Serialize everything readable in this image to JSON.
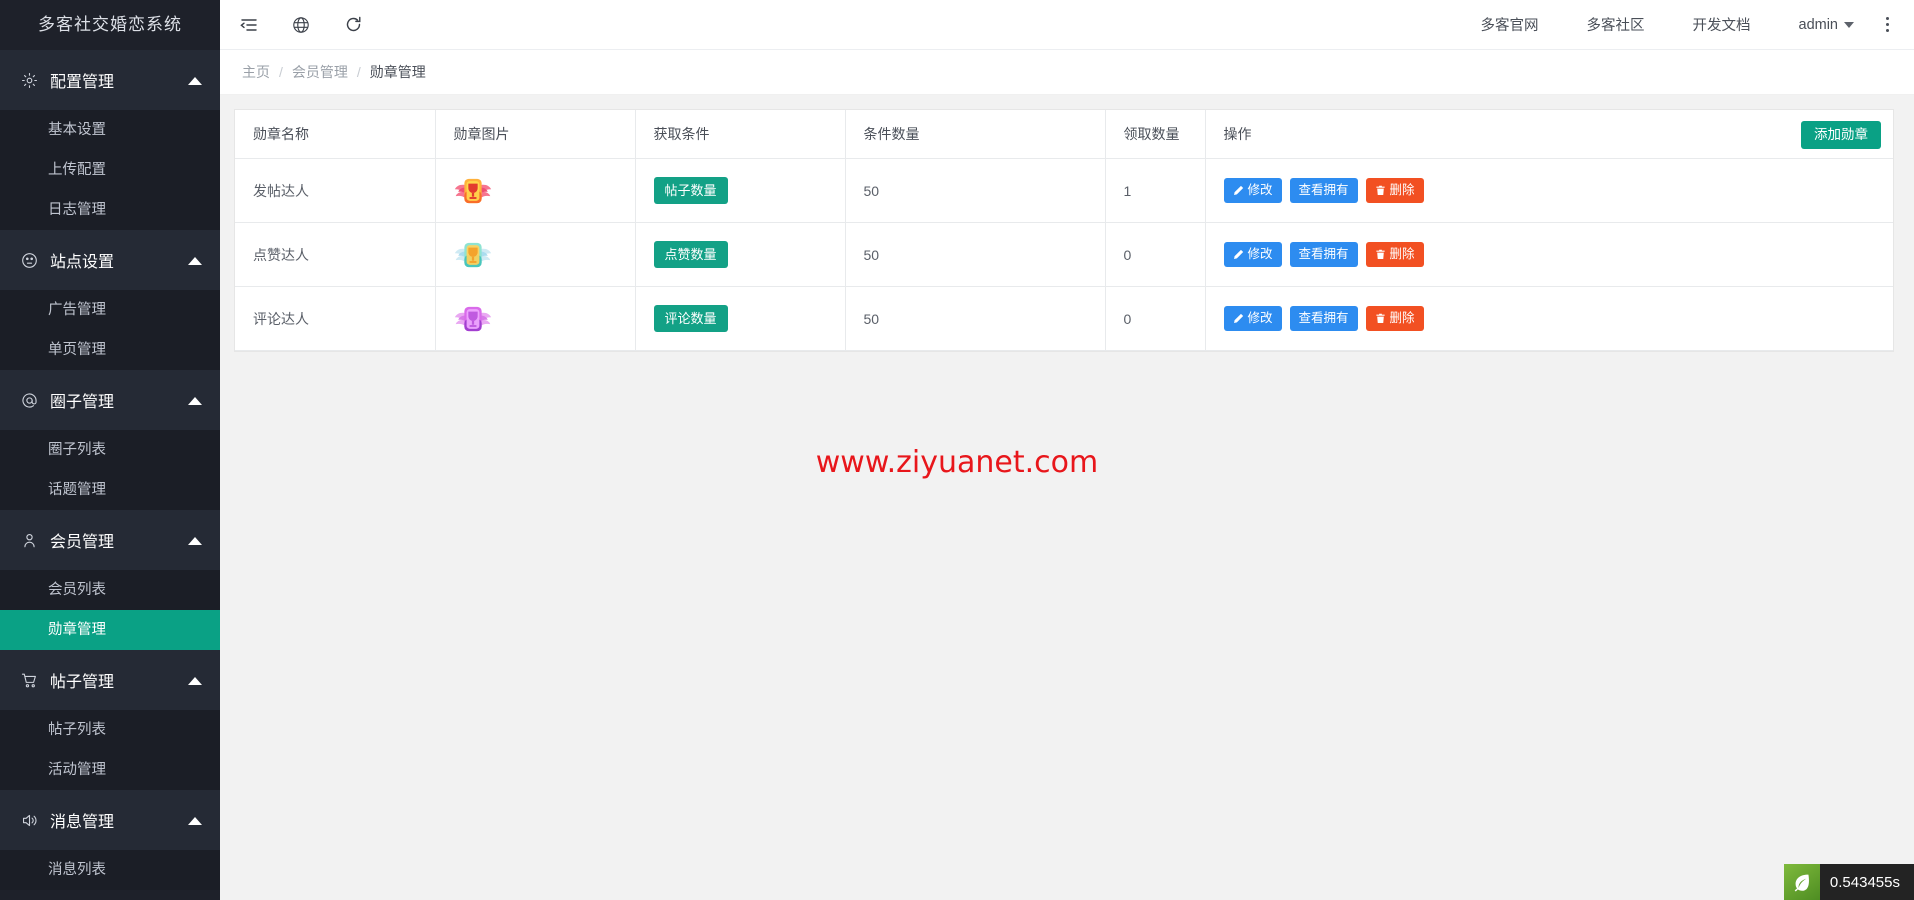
{
  "brand": {
    "title": "多客社交婚恋系统"
  },
  "sidebar": {
    "groups": [
      {
        "label": "配置管理",
        "icon": "gear-icon",
        "items": [
          {
            "label": "基本设置",
            "active": false
          },
          {
            "label": "上传配置",
            "active": false
          },
          {
            "label": "日志管理",
            "active": false
          }
        ]
      },
      {
        "label": "站点设置",
        "icon": "compass-icon",
        "items": [
          {
            "label": "广告管理",
            "active": false
          },
          {
            "label": "单页管理",
            "active": false
          }
        ]
      },
      {
        "label": "圈子管理",
        "icon": "at-icon",
        "items": [
          {
            "label": "圈子列表",
            "active": false
          },
          {
            "label": "话题管理",
            "active": false
          }
        ]
      },
      {
        "label": "会员管理",
        "icon": "user-icon",
        "items": [
          {
            "label": "会员列表",
            "active": false
          },
          {
            "label": "勋章管理",
            "active": true
          }
        ]
      },
      {
        "label": "帖子管理",
        "icon": "cart-icon",
        "items": [
          {
            "label": "帖子列表",
            "active": false
          },
          {
            "label": "活动管理",
            "active": false
          }
        ]
      },
      {
        "label": "消息管理",
        "icon": "speaker-icon",
        "items": [
          {
            "label": "消息列表",
            "active": false
          }
        ]
      }
    ]
  },
  "header": {
    "icons": [
      {
        "name": "menu-fold-icon"
      },
      {
        "name": "globe-icon"
      },
      {
        "name": "refresh-icon"
      }
    ],
    "links": [
      {
        "label": "多客官网"
      },
      {
        "label": "多客社区"
      },
      {
        "label": "开发文档"
      }
    ],
    "user": {
      "label": "admin"
    },
    "more": {
      "name": "kebab-menu-icon"
    }
  },
  "breadcrumb": {
    "items": [
      {
        "label": "主页",
        "current": false
      },
      {
        "label": "会员管理",
        "current": false
      },
      {
        "label": "勋章管理",
        "current": true
      }
    ],
    "separator": "/"
  },
  "table": {
    "add_button": "添加勋章",
    "columns": [
      "勋章名称",
      "勋章图片",
      "获取条件",
      "条件数量",
      "领取数量",
      "操作"
    ],
    "rows": [
      {
        "name": "发帖达人",
        "image": "badge-red-wings",
        "condition": "帖子数量",
        "condition_count": "50",
        "claimed_count": "1",
        "actions": [
          {
            "label": "修改",
            "style": "blue",
            "icon": "pencil-icon"
          },
          {
            "label": "查看拥有",
            "style": "blue",
            "icon": "none"
          },
          {
            "label": "删除",
            "style": "red",
            "icon": "trash-icon"
          }
        ]
      },
      {
        "name": "点赞达人",
        "image": "badge-cyan-wings",
        "condition": "点赞数量",
        "condition_count": "50",
        "claimed_count": "0",
        "actions": [
          {
            "label": "修改",
            "style": "blue",
            "icon": "pencil-icon"
          },
          {
            "label": "查看拥有",
            "style": "blue",
            "icon": "none"
          },
          {
            "label": "删除",
            "style": "red",
            "icon": "trash-icon"
          }
        ]
      },
      {
        "name": "评论达人",
        "image": "badge-purple-wings",
        "condition": "评论数量",
        "condition_count": "50",
        "claimed_count": "0",
        "actions": [
          {
            "label": "修改",
            "style": "blue",
            "icon": "pencil-icon"
          },
          {
            "label": "查看拥有",
            "style": "blue",
            "icon": "none"
          },
          {
            "label": "删除",
            "style": "red",
            "icon": "trash-icon"
          }
        ]
      }
    ]
  },
  "watermark": {
    "text": "www.ziyuanet.com"
  },
  "trace": {
    "icon": "leaf-icon",
    "time": "0.543455s"
  },
  "colors": {
    "sidebar_bg": "#1e212a",
    "sidebar_group_bg": "#252a35",
    "active_green": "#0aa185",
    "tag_green": "#13a186",
    "btn_blue": "#2d8cf0",
    "btn_red": "#f25022",
    "watermark_red": "#e8161b"
  }
}
